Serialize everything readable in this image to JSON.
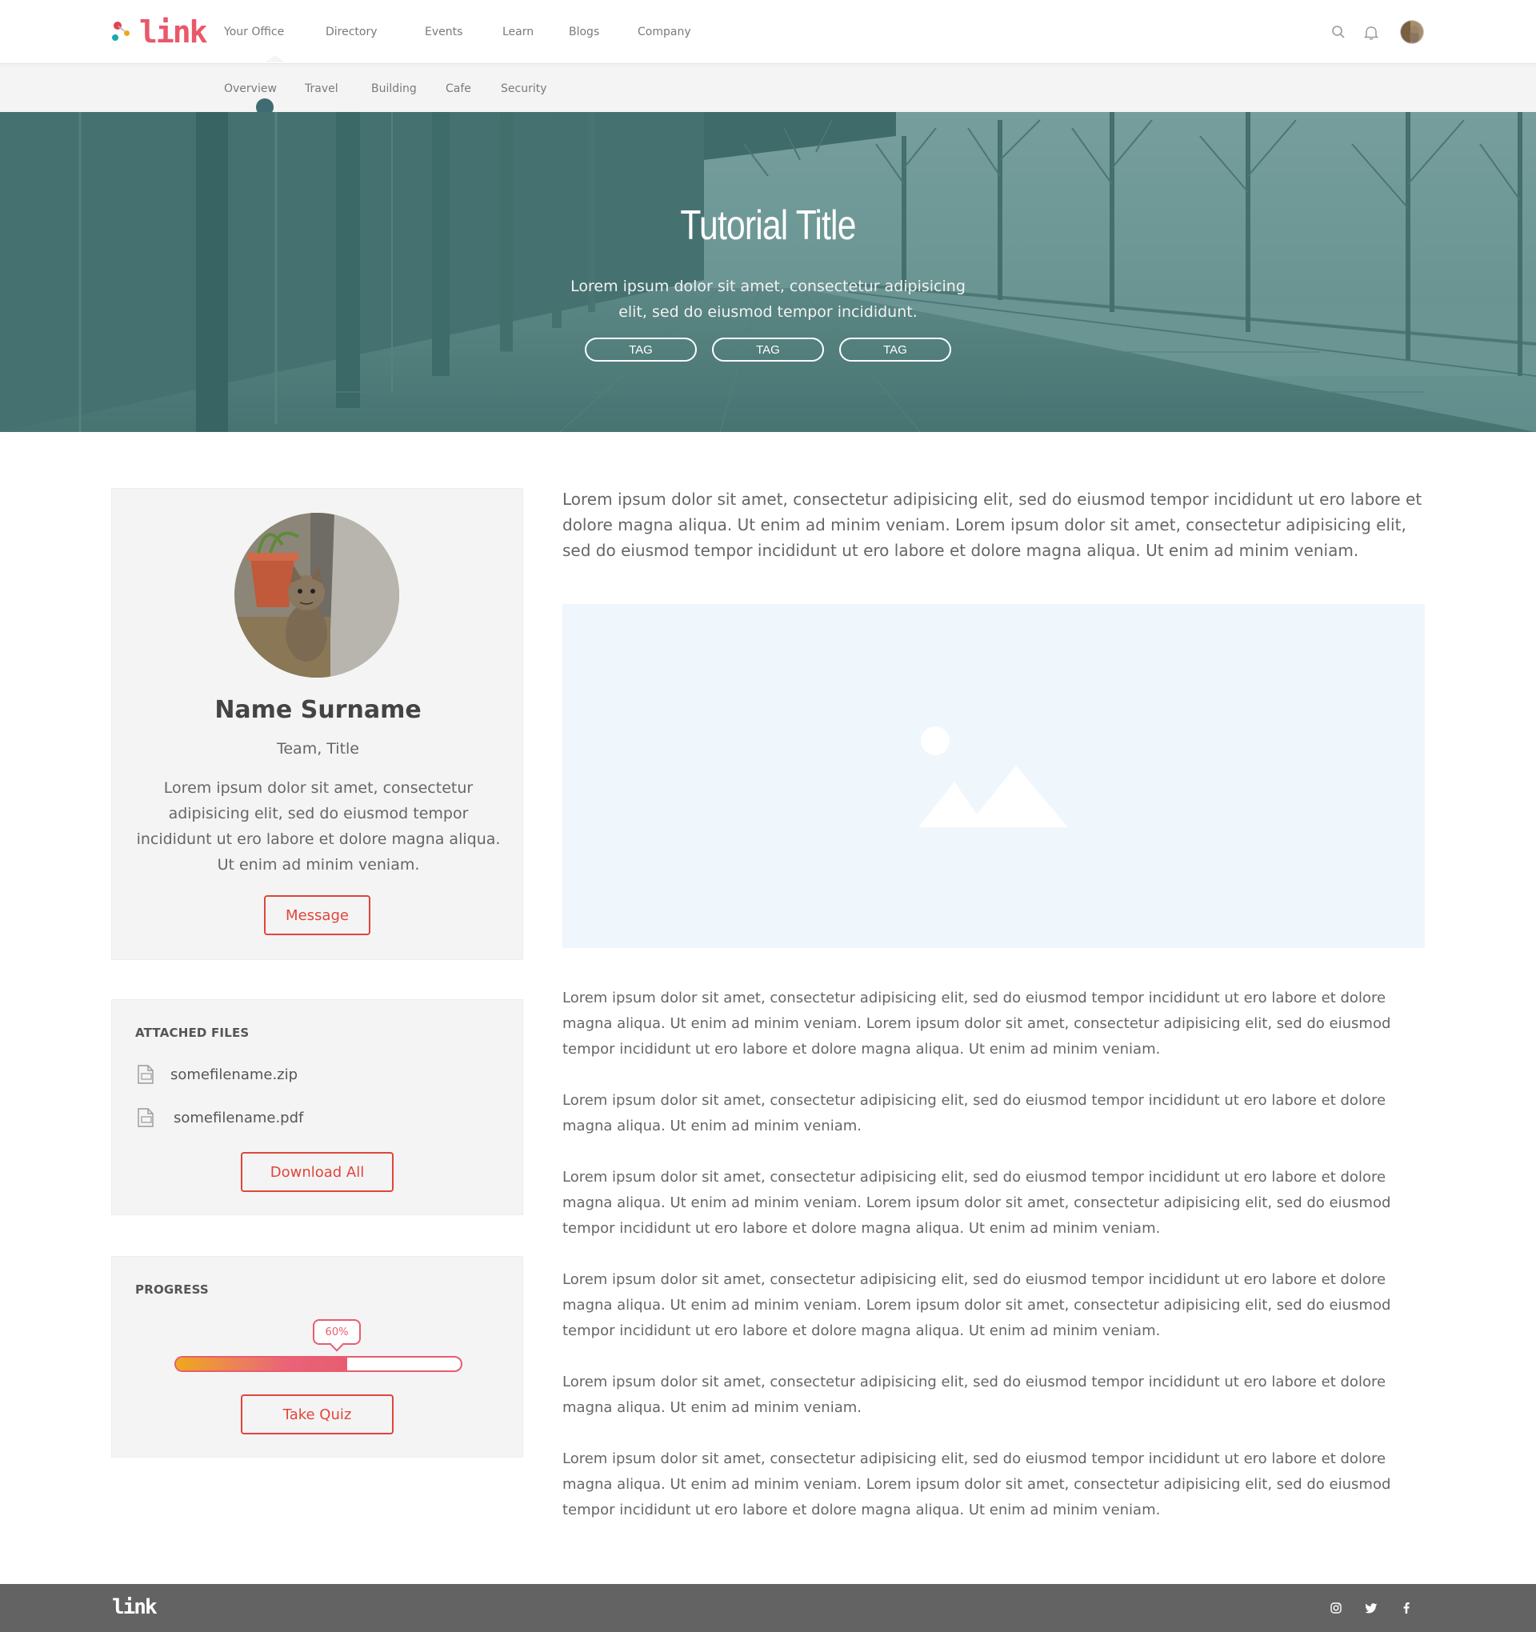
{
  "brand": {
    "name": "link",
    "accent": "#e8596a",
    "button_color": "#e0453c"
  },
  "nav": {
    "items": [
      {
        "label": "Your Office"
      },
      {
        "label": "Directory"
      },
      {
        "label": "Events"
      },
      {
        "label": "Learn"
      },
      {
        "label": "Blogs"
      },
      {
        "label": "Company"
      }
    ],
    "active_index": 0,
    "icons": [
      "search-icon",
      "bell-icon",
      "user-avatar"
    ]
  },
  "subnav": {
    "items": [
      {
        "label": "Overview"
      },
      {
        "label": "Travel"
      },
      {
        "label": "Building"
      },
      {
        "label": "Cafe"
      },
      {
        "label": "Security"
      }
    ],
    "active_index": 0
  },
  "hero": {
    "title": "Tutorial Title",
    "subtitle": "Lorem ipsum dolor sit amet, consectetur adipisicing elit, sed do eiusmod tempor incididunt.",
    "tags": [
      "TAG",
      "TAG",
      "TAG"
    ]
  },
  "profile": {
    "name": "Name Surname",
    "team_title": "Team, Title",
    "bio": "Lorem ipsum dolor sit amet, consectetur adipisicing elit, sed do eiusmod tempor incididunt ut ero labore et dolore magna aliqua. Ut enim ad minim veniam.",
    "message_label": "Message"
  },
  "files": {
    "heading": "ATTACHED FILES",
    "items": [
      {
        "name": "somefilename.zip",
        "icon": "file-icon"
      },
      {
        "name": "somefilename.pdf",
        "icon": "file-icon"
      }
    ],
    "download_label": "Download All"
  },
  "progress": {
    "heading": "PROGRESS",
    "percent": 60,
    "percent_label": "60%",
    "quiz_label": "Take Quiz"
  },
  "content": {
    "lead": "Lorem ipsum dolor sit amet, consectetur adipisicing elit, sed do eiusmod tempor incididunt ut ero labore et dolore magna aliqua. Ut enim ad minim veniam. Lorem ipsum dolor sit amet, consectetur adipisicing elit, sed do eiusmod tempor incididunt ut ero labore et dolore magna aliqua. Ut enim ad minim veniam.",
    "image_placeholder_icon": "image-icon",
    "paragraphs": [
      "Lorem ipsum dolor sit amet, consectetur adipisicing elit, sed do eiusmod tempor incididunt ut ero labore et dolore magna aliqua. Ut enim ad minim veniam. Lorem ipsum dolor sit amet, consectetur adipisicing elit, sed do eiusmod tempor incididunt ut ero labore et dolore magna aliqua. Ut enim ad minim veniam.",
      "Lorem ipsum dolor sit amet, consectetur adipisicing elit, sed do eiusmod tempor incididunt ut ero labore et dolore magna aliqua. Ut enim ad minim veniam.",
      "Lorem ipsum dolor sit amet, consectetur adipisicing elit, sed do eiusmod tempor incididunt ut ero labore et dolore magna aliqua. Ut enim ad minim veniam. Lorem ipsum dolor sit amet, consectetur adipisicing elit, sed do eiusmod tempor incididunt ut ero labore et dolore magna aliqua. Ut enim ad minim veniam.",
      "Lorem ipsum dolor sit amet, consectetur adipisicing elit, sed do eiusmod tempor incididunt ut ero labore et dolore magna aliqua. Ut enim ad minim veniam. Lorem ipsum dolor sit amet, consectetur adipisicing elit, sed do eiusmod tempor incididunt ut ero labore et dolore magna aliqua. Ut enim ad minim veniam.",
      "Lorem ipsum dolor sit amet, consectetur adipisicing elit, sed do eiusmod tempor incididunt ut ero labore et dolore magna aliqua. Ut enim ad minim veniam.",
      "Lorem ipsum dolor sit amet, consectetur adipisicing elit, sed do eiusmod tempor incididunt ut ero labore et dolore magna aliqua. Ut enim ad minim veniam. Lorem ipsum dolor sit amet, consectetur adipisicing elit, sed do eiusmod tempor incididunt ut ero labore et dolore magna aliqua. Ut enim ad minim veniam."
    ]
  },
  "footer": {
    "logo": "link",
    "social": [
      "instagram-icon",
      "twitter-icon",
      "facebook-icon"
    ]
  }
}
